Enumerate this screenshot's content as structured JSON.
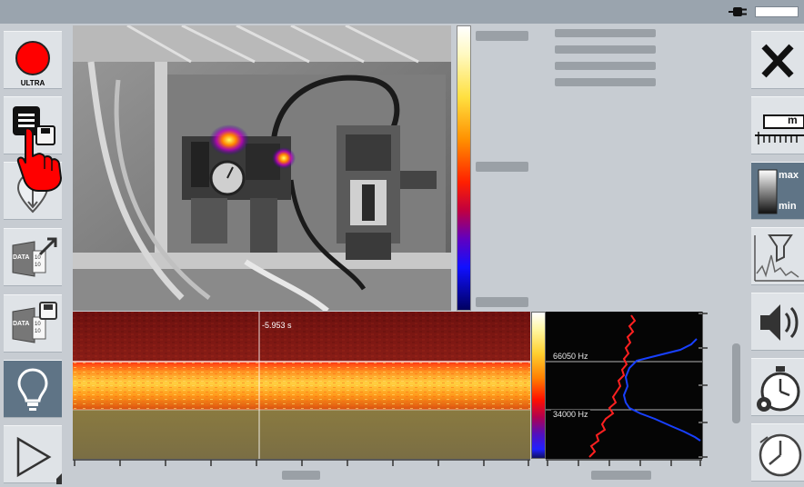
{
  "status_bar": {
    "plug_icon": "plug-icon",
    "battery_icon": "battery-icon"
  },
  "left_toolbar": {
    "record_label": "ULTRA",
    "data_label_top": "DATA",
    "data_label_bottom": "DATA",
    "binary_text": "10\n10"
  },
  "right_toolbar": {
    "scale_unit": "m",
    "max_label": "max",
    "min_label": "min"
  },
  "spectrogram": {
    "cursor_time": "-5.953 s"
  },
  "frequency_plot": {
    "upper_frequency": "66050 Hz",
    "lower_frequency": "34000 Hz"
  },
  "colors": {
    "record": "#ff0000",
    "toolbar_dark": "#5f7486",
    "spectrum_red": "#ff2020",
    "spectrum_blue": "#1840ff"
  }
}
